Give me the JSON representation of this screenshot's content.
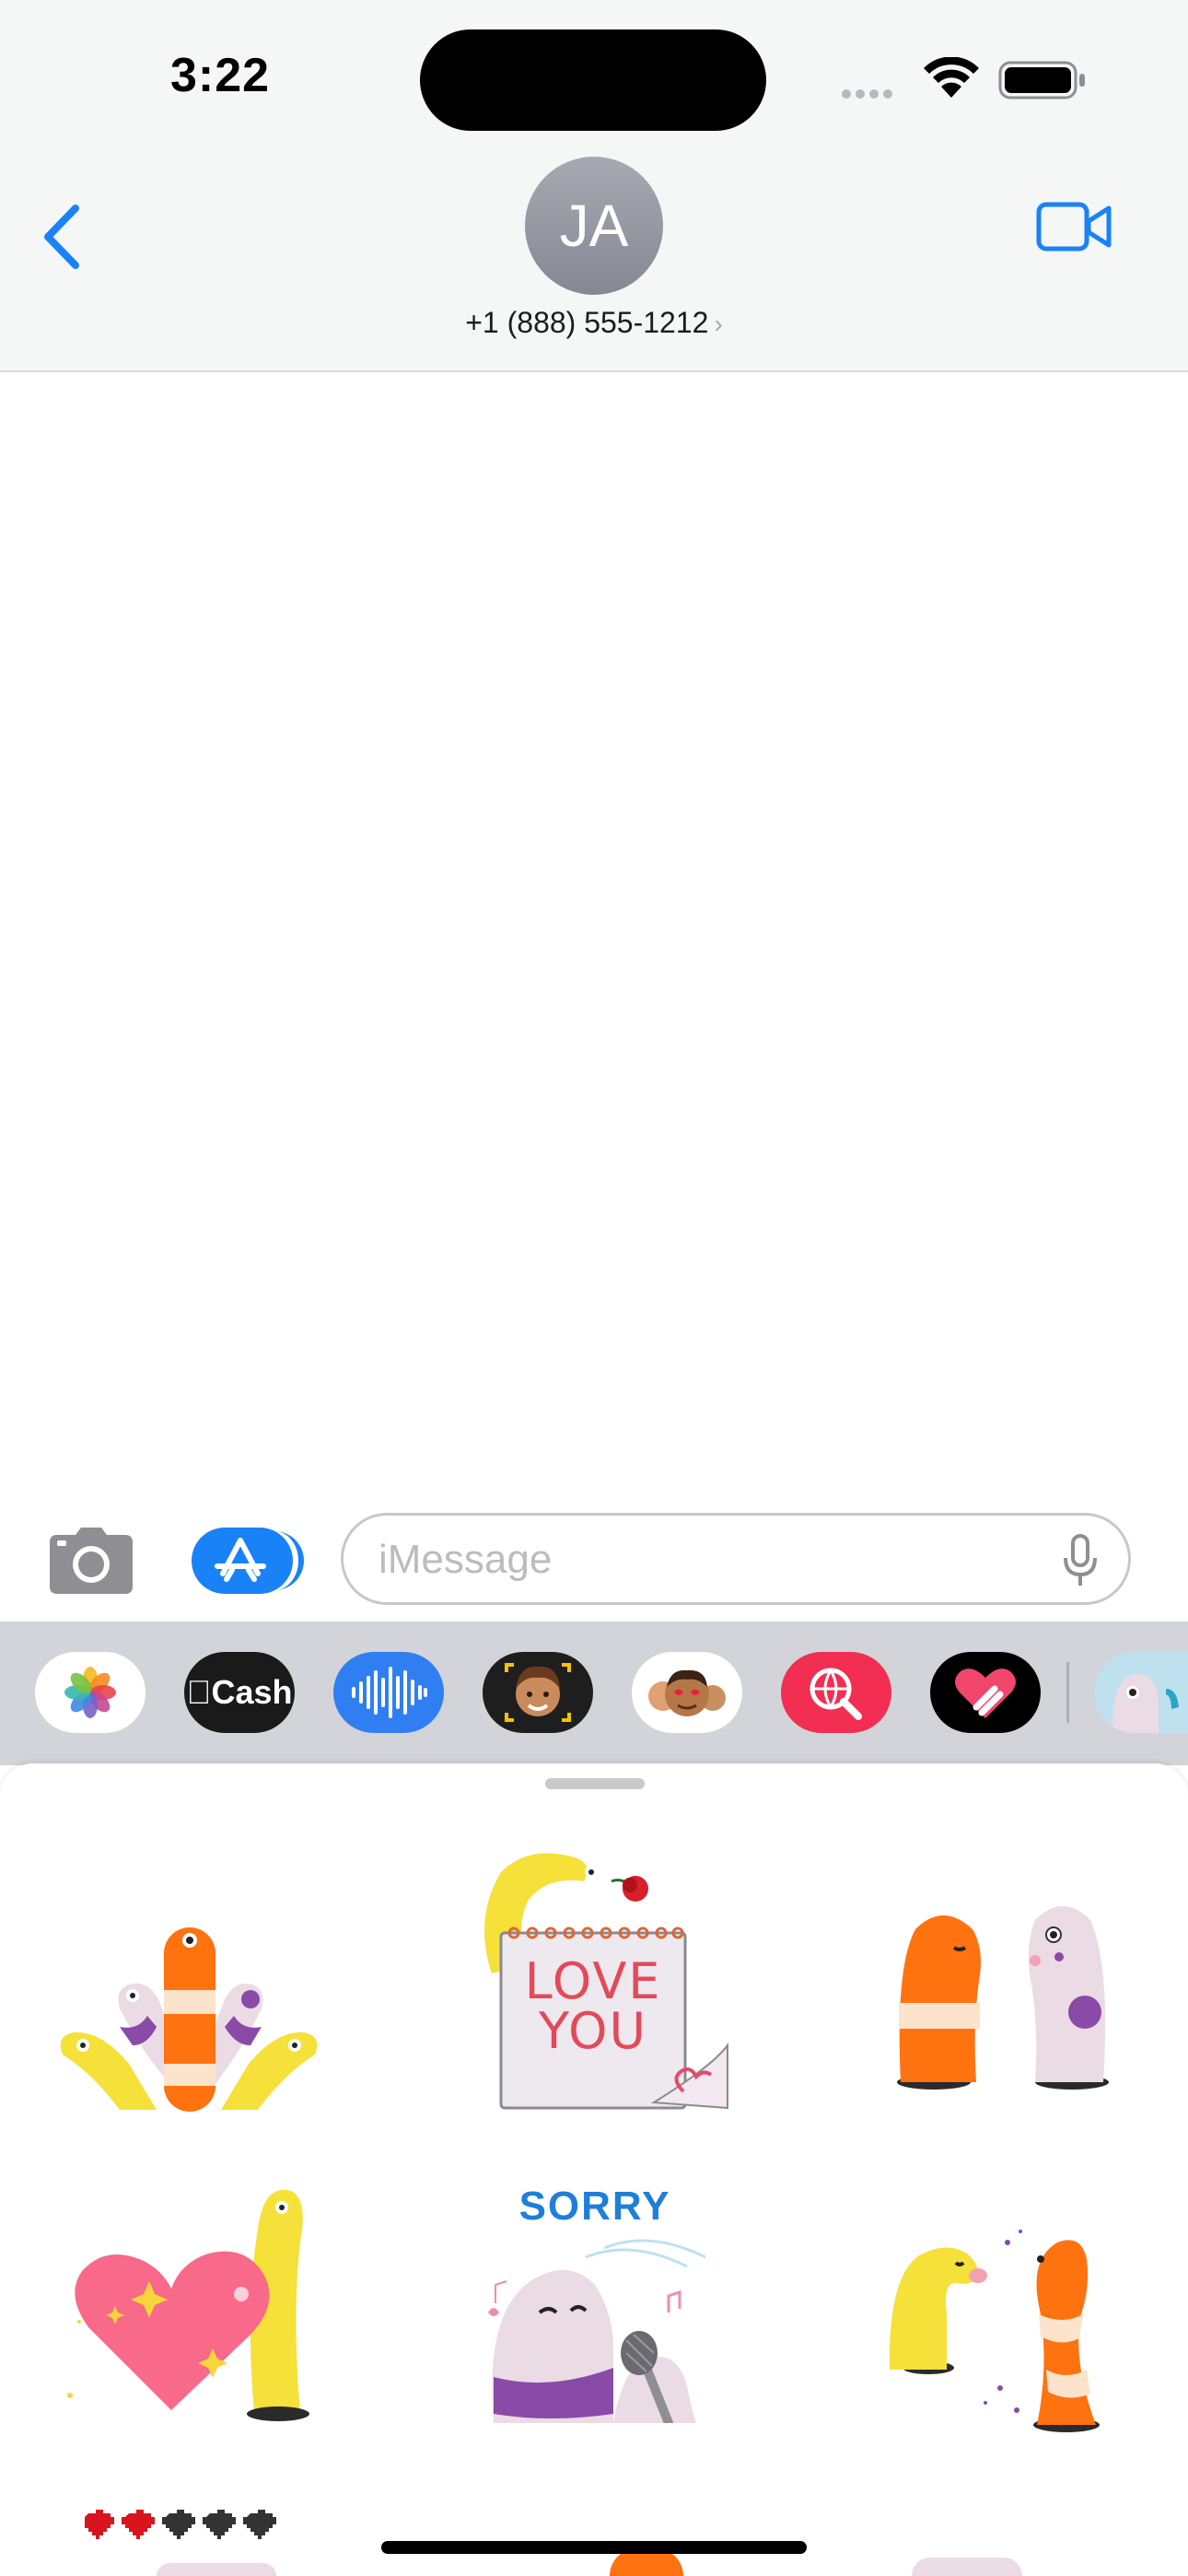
{
  "status_bar": {
    "time": "3:22"
  },
  "header": {
    "avatar_initials": "JA",
    "contact_name": "+1 (888) 555-1212",
    "contact_chevron": "›",
    "back_icon": "chevron-left-icon",
    "video_icon": "video-camera-icon"
  },
  "compose": {
    "camera_icon": "camera-icon",
    "apps_icon": "app-store-icon",
    "placeholder": "iMessage",
    "mic_icon": "microphone-icon"
  },
  "app_drawer": {
    "apps": [
      {
        "name": "Photos",
        "icon": "photos-icon"
      },
      {
        "name": "Cash",
        "label": "Cash",
        "icon": "apple-cash-icon"
      },
      {
        "name": "Audio",
        "icon": "audio-waveform-icon"
      },
      {
        "name": "Memoji",
        "icon": "memoji-icon"
      },
      {
        "name": "Memoji Stickers",
        "icon": "memoji-stickers-icon"
      },
      {
        "name": "Images",
        "icon": "globe-search-icon"
      },
      {
        "name": "Digital Touch",
        "icon": "heart-touch-icon"
      },
      {
        "name": "Sticker Pack",
        "icon": "sticker-pack-icon"
      }
    ]
  },
  "stickers": {
    "items": [
      {
        "name": "eel-group",
        "text": ""
      },
      {
        "name": "love-you",
        "text": "LOVE YOU"
      },
      {
        "name": "eels-kissing",
        "text": ""
      },
      {
        "name": "heart-eel",
        "text": ""
      },
      {
        "name": "sorry-singing",
        "text": "SORRY"
      },
      {
        "name": "eels-blowing-kiss",
        "text": ""
      },
      {
        "name": "hearts-row",
        "text": ""
      }
    ],
    "love_line1": "LOVE",
    "love_line2": "YOU",
    "sorry": "SORRY"
  },
  "colors": {
    "accent_blue": "#1a82f7",
    "eel_orange": "#ff7210",
    "eel_yellow": "#f6e03a",
    "eel_pink": "#ebdbe4",
    "heart_pink": "#f8698a"
  }
}
